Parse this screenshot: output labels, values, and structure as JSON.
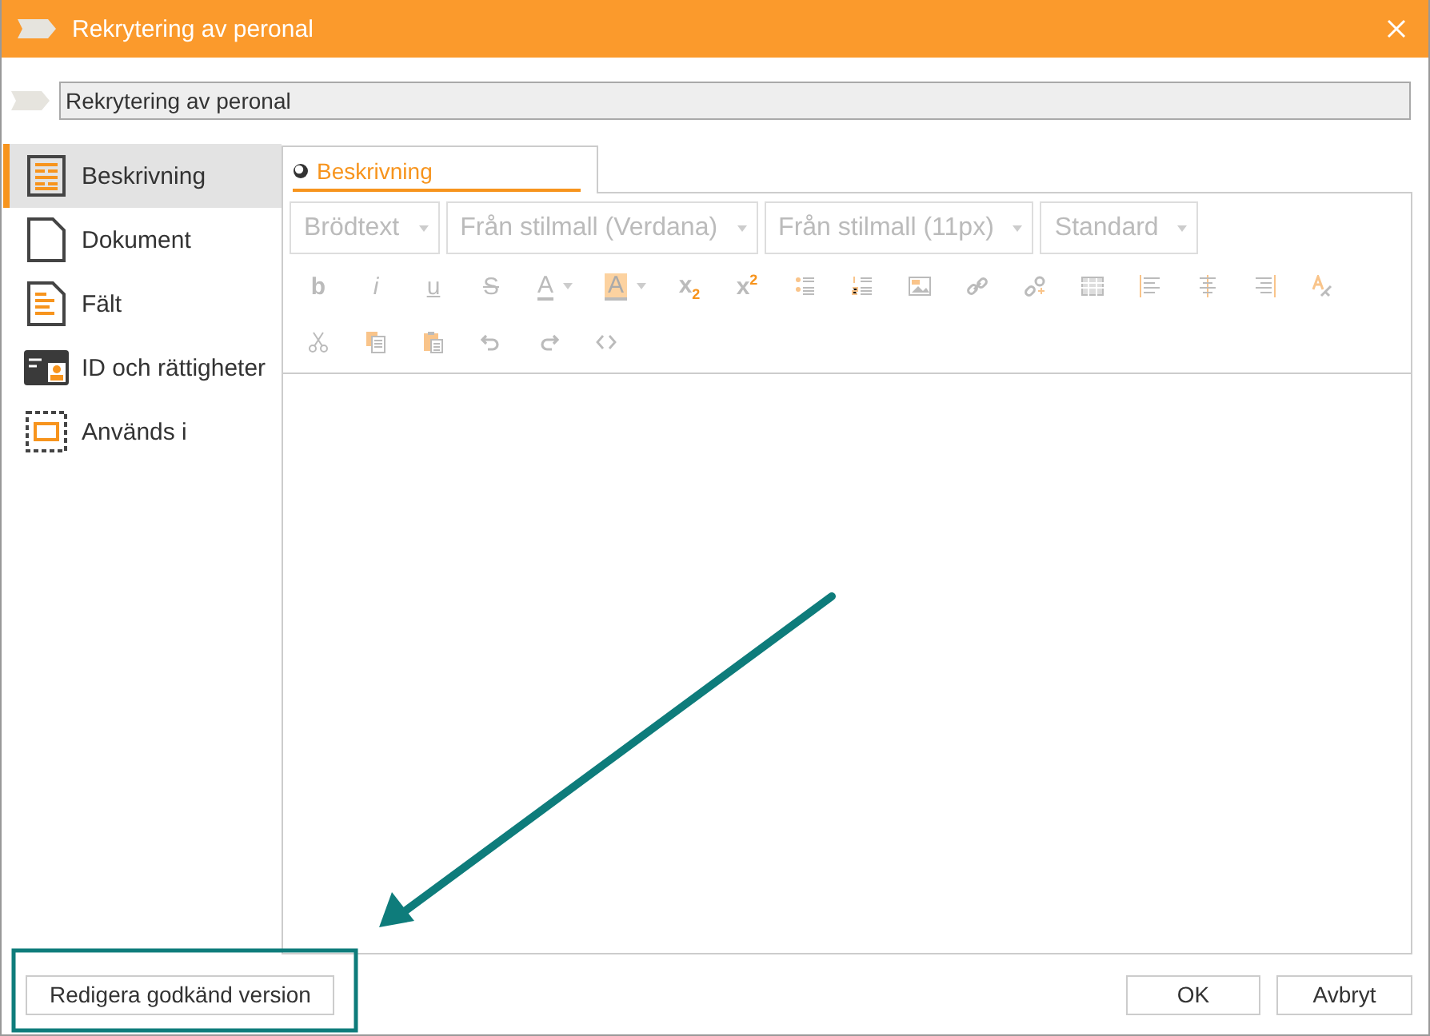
{
  "window": {
    "title": "Rekrytering av peronal"
  },
  "name_field": {
    "value": "Rekrytering av peronal"
  },
  "sidebar": {
    "items": [
      {
        "label": "Beskrivning",
        "kind": "text",
        "selected": true
      },
      {
        "label": "Dokument",
        "kind": "document",
        "selected": false
      },
      {
        "label": "Fält",
        "kind": "fields",
        "selected": false
      },
      {
        "label": "ID och rättigheter",
        "kind": "id",
        "selected": false
      },
      {
        "label": "Används i",
        "kind": "usage",
        "selected": false
      }
    ]
  },
  "tabs": [
    {
      "label": "Beskrivning",
      "selected": true
    }
  ],
  "editor": {
    "dropdowns": [
      "Brödtext",
      "Från stilmall (Verdana)",
      "Från stilmall (11px)",
      "Standard"
    ],
    "toolbar_rows": [
      [
        {
          "kind": "bold",
          "text": "b"
        },
        {
          "kind": "italic",
          "text": "i"
        },
        {
          "kind": "underline",
          "text": "u"
        },
        {
          "kind": "strike",
          "text": "S"
        },
        {
          "kind": "color",
          "text": "A"
        },
        {
          "kind": "highlight",
          "text": "A"
        },
        {
          "kind": "script",
          "text": "x$_{2}$"
        },
        {
          "kind": "script",
          "text": "x$^{2}$"
        },
        {
          "kind": "bullets"
        },
        {
          "kind": "numbers"
        },
        {
          "kind": "image"
        },
        {
          "kind": "link"
        },
        {
          "kind": "unlink"
        },
        {
          "kind": "table"
        },
        {
          "kind": "align-left"
        },
        {
          "kind": "align-center"
        },
        {
          "kind": "align-right"
        },
        {
          "kind": "clear-format"
        }
      ],
      [
        {
          "kind": "cut"
        },
        {
          "kind": "copy"
        },
        {
          "kind": "paste"
        },
        {
          "kind": "undo"
        },
        {
          "kind": "redo"
        },
        {
          "kind": "source"
        }
      ]
    ]
  },
  "footer": {
    "left_button": "Redigera godkänd version",
    "buttons": [
      "OK",
      "Avbryt"
    ]
  }
}
